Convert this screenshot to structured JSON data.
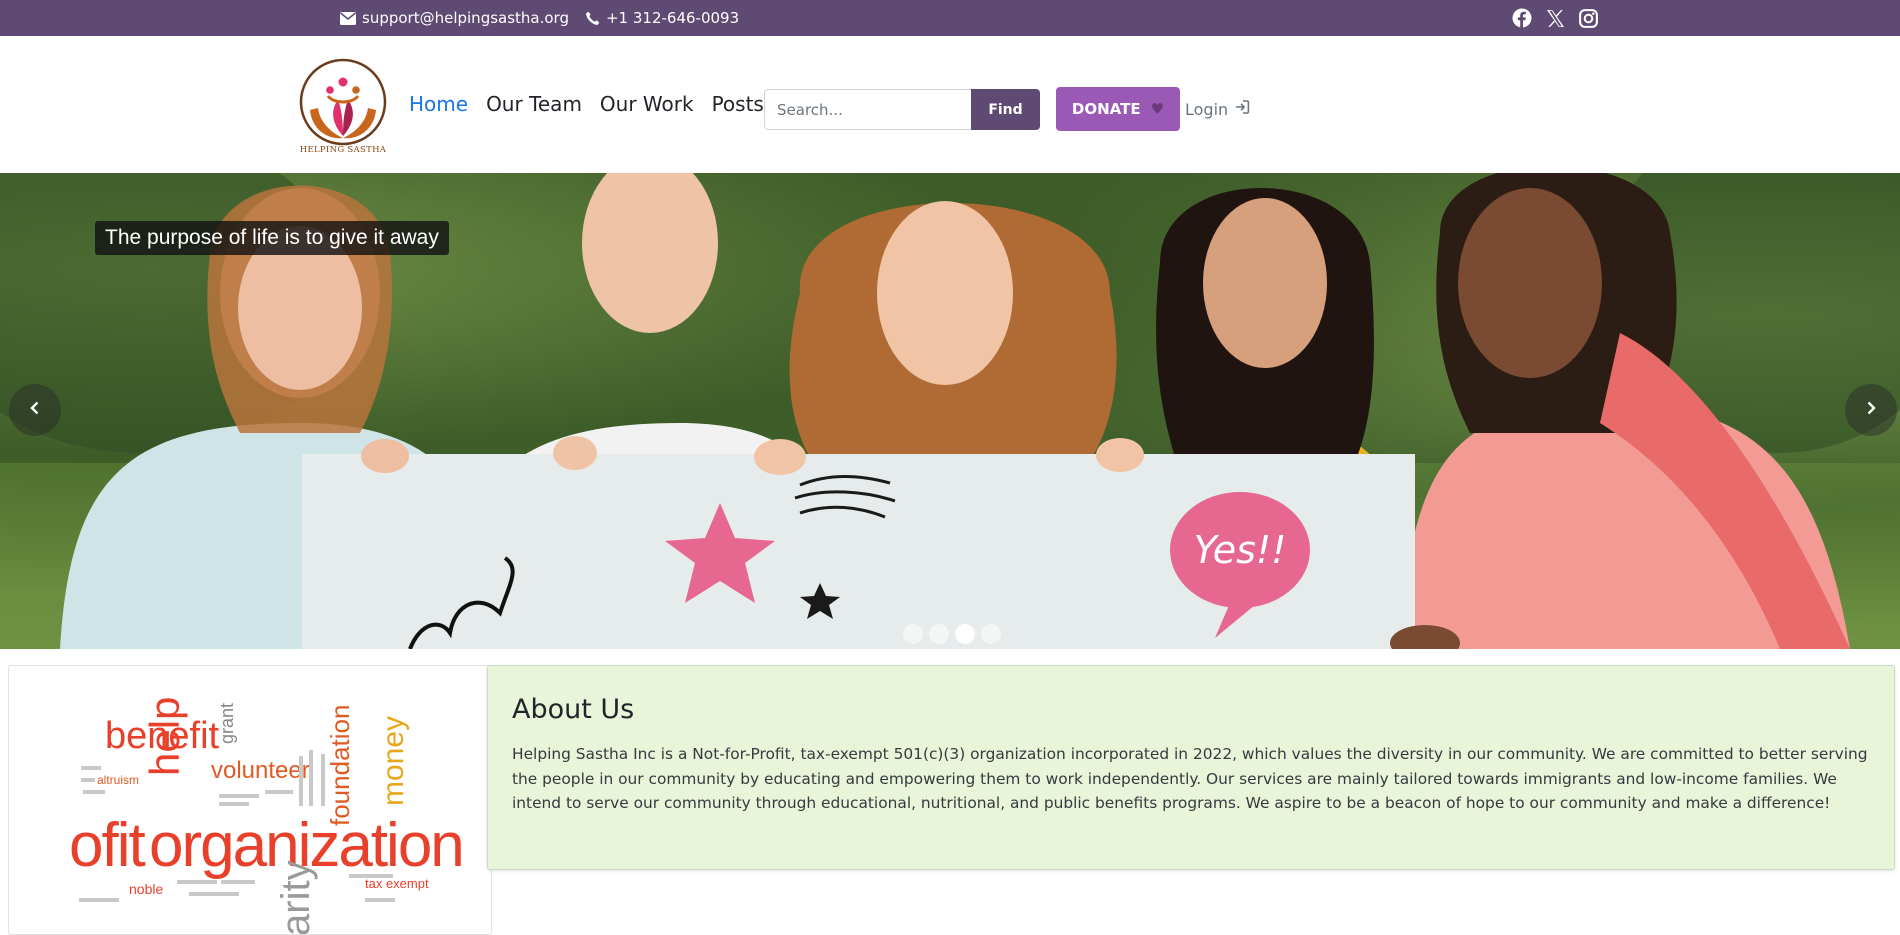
{
  "topbar": {
    "email": "support@helpingsastha.org",
    "phone": "+1 312-646-0093",
    "social": [
      "facebook-icon",
      "x-icon",
      "instagram-icon"
    ],
    "bg_color": "#5e4a72"
  },
  "brand": {
    "logo_text": "HELPING SASTHA"
  },
  "nav": {
    "home": "Home",
    "team": "Our Team",
    "work": "Our Work",
    "posts": "Posts",
    "active_color": "#1a73e8"
  },
  "search": {
    "placeholder": "Search...",
    "button": "Find"
  },
  "donate": {
    "label": "DONATE",
    "color": "#9b59b6"
  },
  "login": {
    "label": "Login"
  },
  "carousel": {
    "caption": "The purpose of life is to give it away",
    "sign_text": "Yes!!",
    "slide_count": 4,
    "active_slide": 3
  },
  "wordcloud": {
    "words": [
      "benefit",
      "help",
      "volunteer",
      "grant",
      "money",
      "foundation",
      "ofit",
      "organization",
      "arity",
      "tax exempt",
      "noble",
      "altruism"
    ]
  },
  "about": {
    "title": "About Us",
    "body": "Helping Sastha Inc is a Not-for-Profit, tax-exempt 501(c)(3) organization incorporated in 2022, which values the diversity in our community. We are committed to better serving the people in our community by educating and empowering them to work independently. Our services are mainly tailored towards immigrants and low-income families. We intend to serve our community through educational, nutritional, and public benefits programs. We aspire to be a beacon of hope to our community and make a difference!",
    "bg_color": "#e8f5d9"
  }
}
